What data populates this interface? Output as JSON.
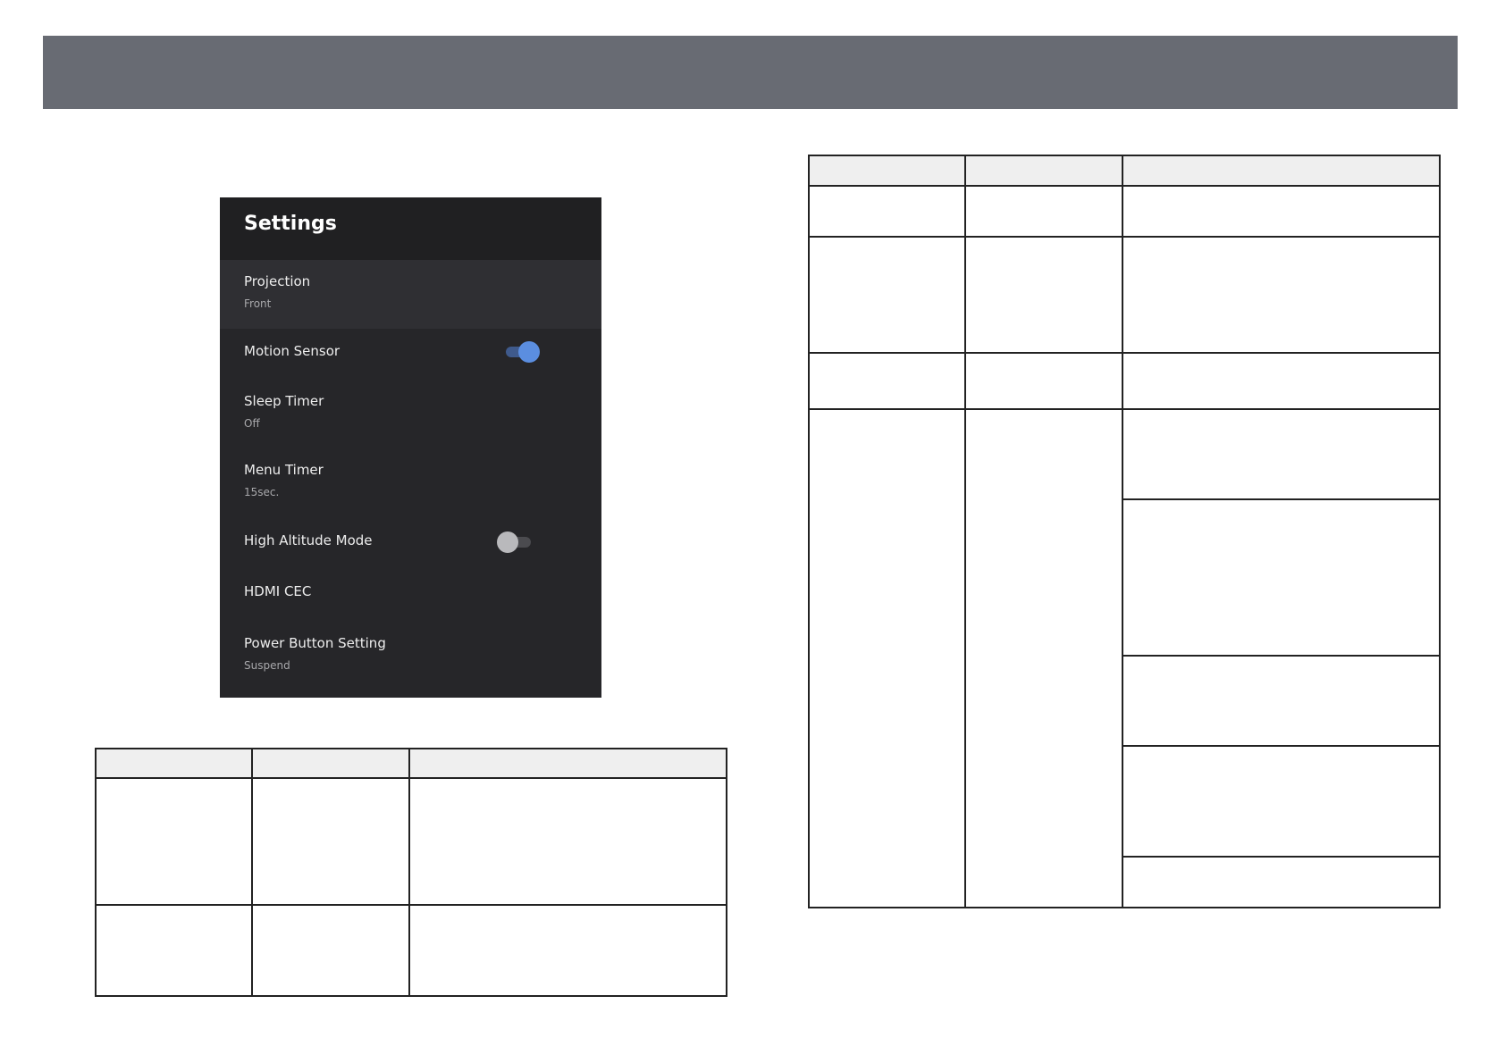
{
  "settings": {
    "title": "Settings",
    "items": [
      {
        "label": "Projection",
        "value": "Front"
      },
      {
        "label": "Motion Sensor",
        "toggle": "on"
      },
      {
        "label": "Sleep Timer",
        "value": "Off"
      },
      {
        "label": "Menu Timer",
        "value": "15sec."
      },
      {
        "label": "High Altitude Mode",
        "toggle": "off"
      },
      {
        "label": "HDMI CEC"
      },
      {
        "label": "Power Button Setting",
        "value": "Suspend"
      }
    ]
  },
  "colors": {
    "header_bar": "#686b73",
    "panel_background": "#262629",
    "toggle_on": "#5b8ee0",
    "toggle_off": "#b9b9bc"
  }
}
